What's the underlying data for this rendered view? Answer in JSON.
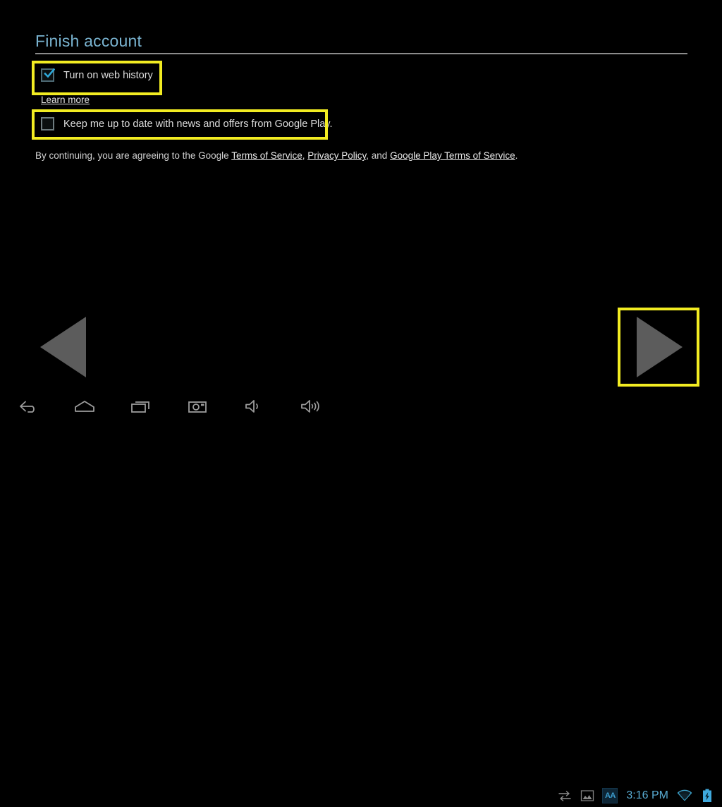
{
  "screen": {
    "title": "Finish account"
  },
  "options": [
    {
      "id": "web-history",
      "label": "Turn on web history",
      "checked": true,
      "highlighted": true
    },
    {
      "id": "news-offers",
      "label": "Keep me up to date with news and offers from Google Play.",
      "checked": false,
      "highlighted": true
    }
  ],
  "links": {
    "learn_more": "Learn more"
  },
  "legal": {
    "prefix": "By continuing, you are agreeing to the Google ",
    "terms_of_service": "Terms of Service",
    "sep1": ", ",
    "privacy_policy": "Privacy Policy",
    "sep2": ", and ",
    "play_terms": "Google Play Terms of Service",
    "suffix": "."
  },
  "navigation": {
    "prev_label": "Previous",
    "next_label": "Next",
    "next_highlighted": true
  },
  "system_nav": {
    "buttons": [
      {
        "name": "back-icon",
        "label": "Back"
      },
      {
        "name": "home-icon",
        "label": "Home"
      },
      {
        "name": "recents-icon",
        "label": "Recent apps"
      },
      {
        "name": "screenshot-icon",
        "label": "Screenshot"
      },
      {
        "name": "volume-down-icon",
        "label": "Volume down"
      },
      {
        "name": "volume-up-icon",
        "label": "Volume up"
      }
    ]
  },
  "status_bar": {
    "data-transfer-icon": "data-transfer",
    "gallery-icon": "gallery",
    "aa_badge": "AA",
    "time": "3:16 PM",
    "wifi-icon": "wifi",
    "battery-icon": "battery-charging"
  },
  "colors": {
    "background": "#000000",
    "title": "#79b3d0",
    "highlight": "#f2ec22",
    "accent_cyan": "#2ea8d8",
    "arrow_gray": "#5c5c5c",
    "divider": "#8c8c8c",
    "status_blue": "#58abd2"
  }
}
